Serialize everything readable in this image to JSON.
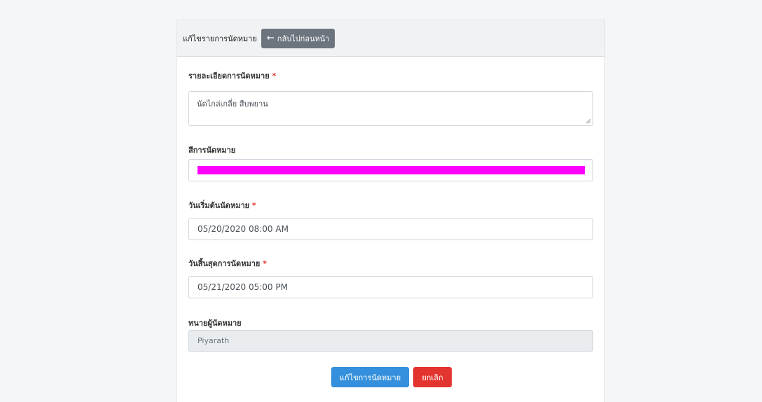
{
  "header": {
    "title": "แก้ไขรายการนัดหมาย",
    "back_label": "กลับไปก่อนหน้า",
    "back_icon": "arrow-left-icon"
  },
  "form": {
    "detail": {
      "label": "รายละเอียดการนัดหมาย",
      "required_mark": "*",
      "value": "นัดไกล่เกลี่ย สืบพยาน"
    },
    "color": {
      "label": "สีการนัดหมาย",
      "value": "#ff00ff"
    },
    "start": {
      "label": "วันเริ่มต้นนัดหมาย",
      "required_mark": "*",
      "value": "05/20/2020 08:00 AM"
    },
    "end": {
      "label": "วันสิ้นสุดการนัดหมาย",
      "required_mark": "*",
      "value": "05/21/2020 05:00 PM"
    },
    "lawyer": {
      "label": "ทนายผู้นัดหมาย",
      "value": "Piyarath"
    }
  },
  "actions": {
    "submit_label": "แก้ไขการนัดหมาย",
    "cancel_label": "ยกเลิก"
  },
  "colors": {
    "primary": "#3490dc",
    "danger": "#e3342f",
    "secondary": "#6c757d",
    "swatch": "#ff00ff"
  }
}
